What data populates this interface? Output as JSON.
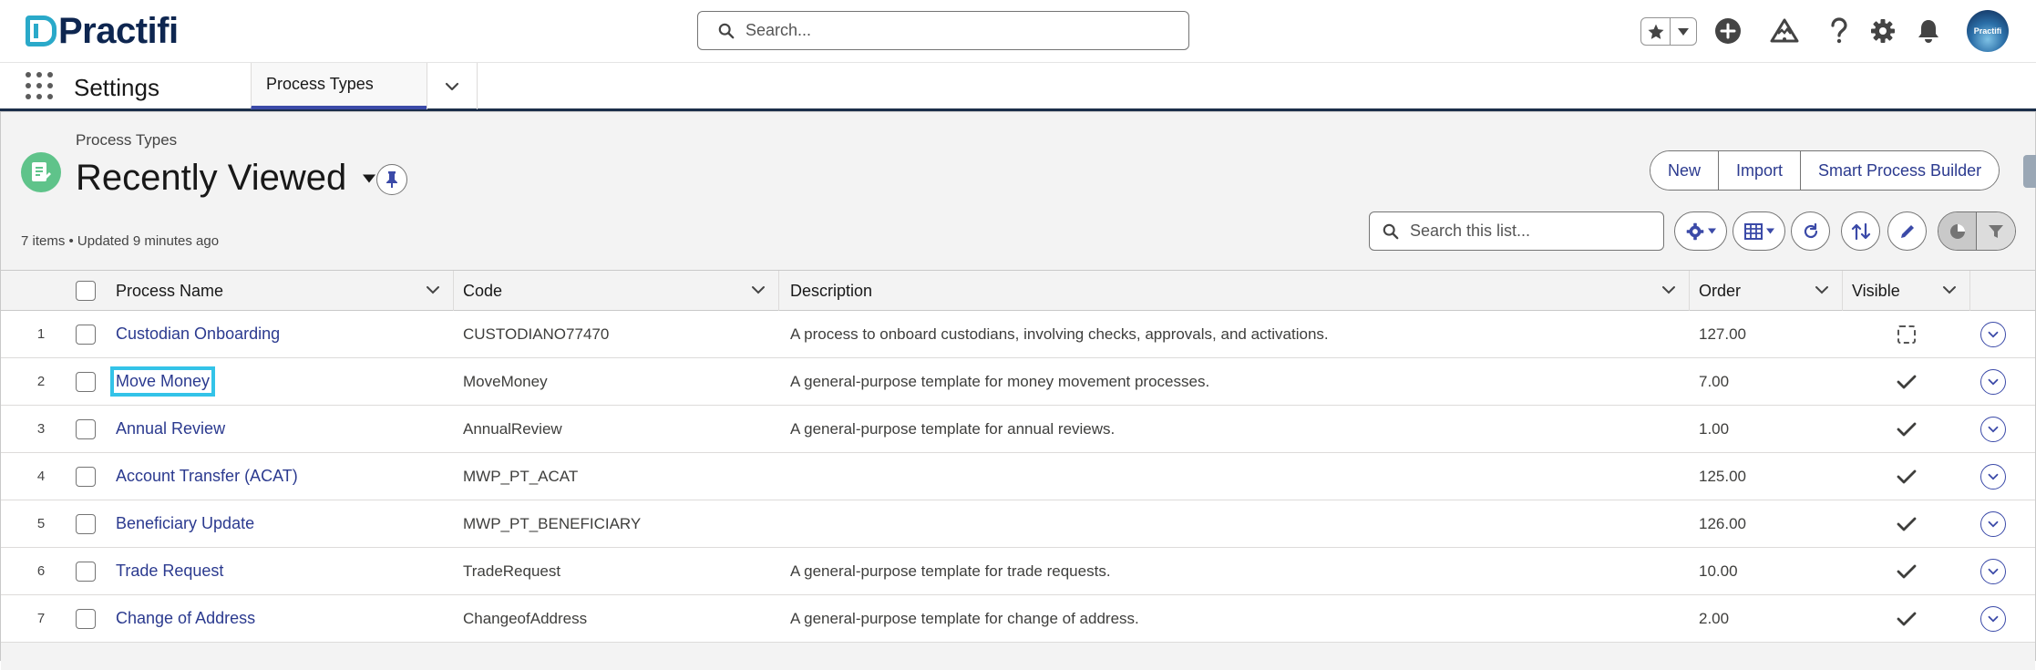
{
  "header": {
    "logo_text": "Practifi",
    "search_placeholder": "Search...",
    "avatar_label": "Practifi"
  },
  "nav": {
    "app_name": "Settings",
    "tab_label": "Process Types"
  },
  "list_view": {
    "object_name": "Process Types",
    "title": "Recently Viewed",
    "meta": "7 items • Updated 9 minutes ago",
    "buttons": [
      "New",
      "Import",
      "Smart Process Builder"
    ],
    "search_placeholder": "Search this list..."
  },
  "table": {
    "columns": [
      "Process Name",
      "Code",
      "Description",
      "Order",
      "Visible"
    ],
    "rows": [
      {
        "num": "1",
        "name": "Custodian Onboarding",
        "code": "CUSTODIANO77470",
        "description": "A process to onboard custodians, involving checks, approvals, and activations.",
        "order": "127.00",
        "visible": false
      },
      {
        "num": "2",
        "name": "Move Money",
        "code": "MoveMoney",
        "description": "A general-purpose template for money movement processes.",
        "order": "7.00",
        "visible": true
      },
      {
        "num": "3",
        "name": "Annual Review",
        "code": "AnnualReview",
        "description": "A general-purpose template for annual reviews.",
        "order": "1.00",
        "visible": true
      },
      {
        "num": "4",
        "name": "Account Transfer (ACAT)",
        "code": "MWP_PT_ACAT",
        "description": "",
        "order": "125.00",
        "visible": true
      },
      {
        "num": "5",
        "name": "Beneficiary Update",
        "code": "MWP_PT_BENEFICIARY",
        "description": "",
        "order": "126.00",
        "visible": true
      },
      {
        "num": "6",
        "name": "Trade Request",
        "code": "TradeRequest",
        "description": "A general-purpose template for trade requests.",
        "order": "10.00",
        "visible": true
      },
      {
        "num": "7",
        "name": "Change of Address",
        "code": "ChangeofAddress",
        "description": "A general-purpose template for change of address.",
        "order": "2.00",
        "visible": true
      }
    ]
  },
  "colors": {
    "brand_navy": "#0e2650",
    "brand_cyan": "#2aa9c9",
    "link": "#2b3a8f",
    "object_icon": "#5fc38a",
    "focus_ring": "#33c3e8"
  }
}
